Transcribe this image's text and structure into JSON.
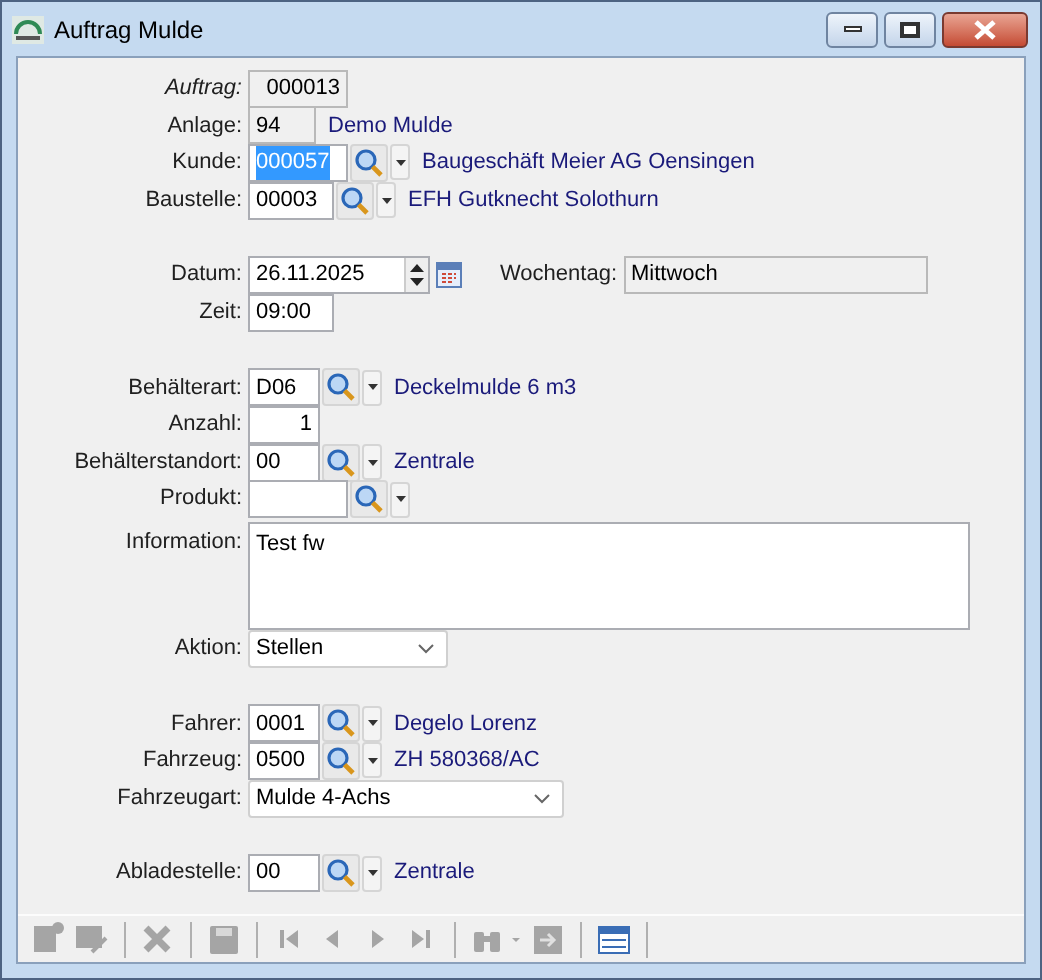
{
  "window": {
    "title": "Auftrag Mulde"
  },
  "sections": [
    [
      {
        "kind": "readonly",
        "label": "Auftrag:",
        "italic": true,
        "value": "000013"
      },
      {
        "kind": "readonly",
        "label": "Anlage:",
        "value": "94",
        "description": "Demo Mulde"
      },
      {
        "kind": "lookup",
        "label": "Kunde:",
        "value": "000057",
        "text_selected": true,
        "description": "Baugeschäft Meier AG Oensingen"
      },
      {
        "kind": "lookup",
        "label": "Baustelle:",
        "value": "00003",
        "description": "EFH Gutknecht Solothurn"
      }
    ],
    [
      {
        "kind": "date",
        "label": "Datum:",
        "value": "26.11.2025",
        "side_label": "Wochentag:",
        "side_value": "Mittwoch"
      },
      {
        "kind": "text",
        "label": "Zeit:",
        "value": "09:00"
      }
    ],
    [
      {
        "kind": "lookup",
        "label": "Behälterart:",
        "value": "D06",
        "description": "Deckelmulde 6 m3"
      },
      {
        "kind": "text",
        "label": "Anzahl:",
        "value": "1"
      },
      {
        "kind": "lookup",
        "label": "Behälterstandort:",
        "value": "00",
        "description": "Zentrale"
      },
      {
        "kind": "lookup",
        "label": "Produkt:"
      },
      {
        "kind": "textarea",
        "label": "Information:",
        "value": "Test fw"
      },
      {
        "kind": "select",
        "label": "Aktion:",
        "value": "Stellen"
      }
    ],
    [
      {
        "kind": "lookup",
        "label": "Fahrer:",
        "value": "0001",
        "description": "Degelo Lorenz"
      },
      {
        "kind": "lookup",
        "label": "Fahrzeug:",
        "value": "0500",
        "description": "ZH 580368/AC"
      },
      {
        "kind": "select",
        "label": "Fahrzeugart:",
        "value": "Mulde 4-Achs"
      }
    ],
    [
      {
        "kind": "lookup",
        "label": "Abladestelle:",
        "value": "00",
        "description": "Zentrale"
      }
    ]
  ],
  "toolbar": [
    {
      "kind": "new",
      "disabled": true
    },
    {
      "kind": "edit",
      "disabled": true
    },
    {
      "kind": "sep"
    },
    {
      "kind": "delete",
      "disabled": true
    },
    {
      "kind": "sep"
    },
    {
      "kind": "save",
      "disabled": true
    },
    {
      "kind": "sep"
    },
    {
      "kind": "first",
      "disabled": true
    },
    {
      "kind": "prev",
      "disabled": true
    },
    {
      "kind": "next",
      "disabled": true
    },
    {
      "kind": "last",
      "disabled": true
    },
    {
      "kind": "sep"
    },
    {
      "kind": "find",
      "disabled": true
    },
    {
      "kind": "export",
      "disabled": true
    },
    {
      "kind": "sep"
    },
    {
      "kind": "list",
      "disabled": false
    },
    {
      "kind": "sep"
    }
  ]
}
